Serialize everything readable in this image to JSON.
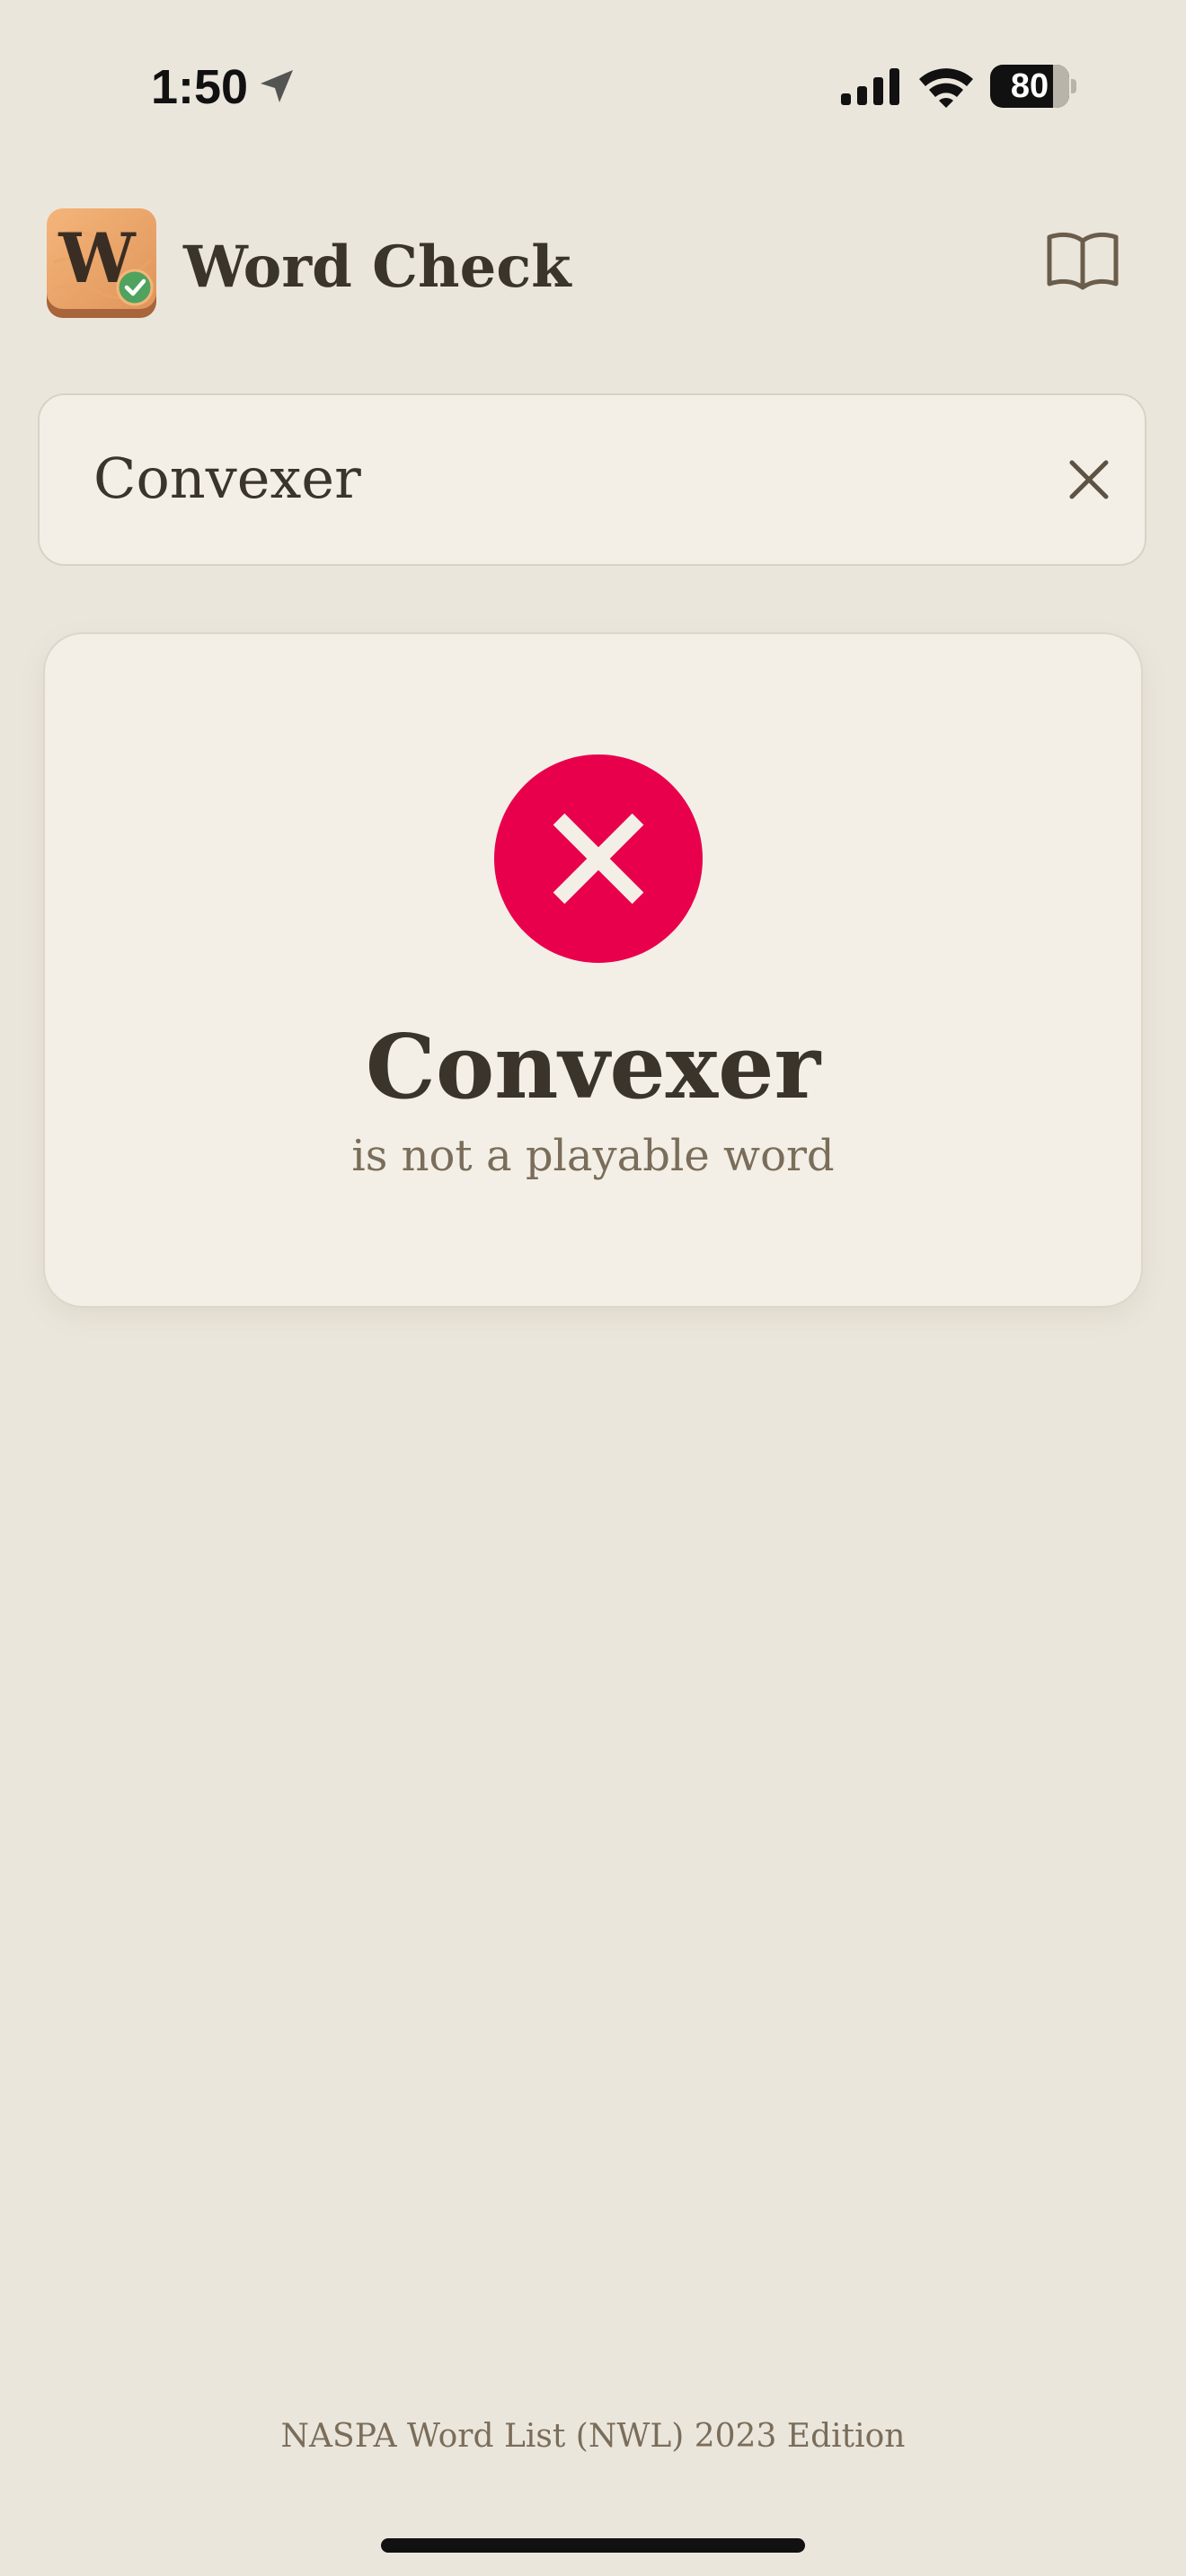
{
  "status_bar": {
    "time": "1:50",
    "battery_level": "80",
    "battery_percent": 80,
    "icons": [
      "location-arrow-icon",
      "cellular-signal-icon",
      "wifi-icon",
      "battery-icon"
    ]
  },
  "header": {
    "title": "Word Check",
    "app_icon_letter": "W",
    "dictionary_icon": "open-book-icon"
  },
  "search": {
    "value": "Convexer",
    "clear_icon": "close-icon"
  },
  "result": {
    "word": "Convexer",
    "message": "is not a playable word",
    "status": "invalid",
    "status_icon": "x-circle-icon",
    "status_color": "#E8004D"
  },
  "footer": {
    "edition": "NASPA Word List (NWL) 2023 Edition"
  },
  "colors": {
    "background": "#EBE6DC",
    "card": "#F3EFE6",
    "text": "#3A342A",
    "muted_text": "#7A6D5A",
    "error": "#E8004D"
  }
}
